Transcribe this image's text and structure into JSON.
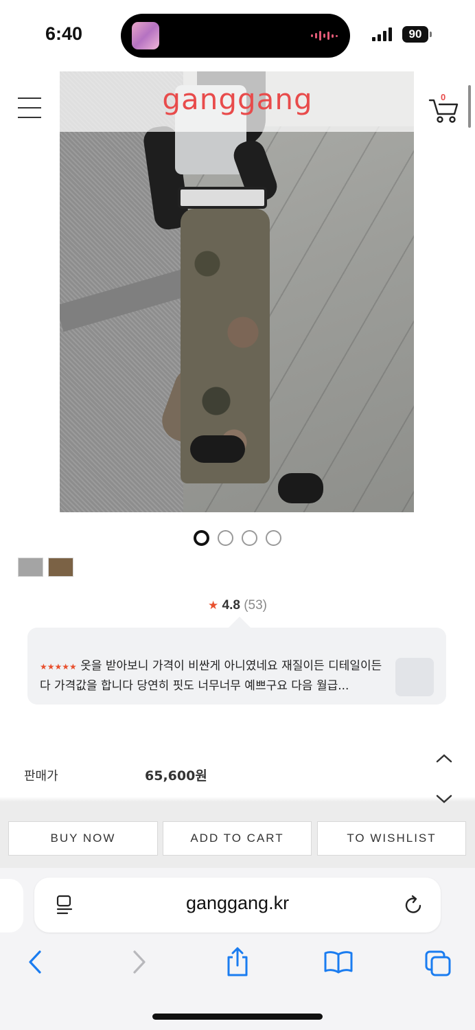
{
  "status_bar": {
    "time": "6:40",
    "battery": "90"
  },
  "header": {
    "logo": "ganggang",
    "cart_count": "0"
  },
  "gallery": {
    "slides": 4,
    "active_index": 0
  },
  "swatches": [
    {
      "color": "#a4a4a4"
    },
    {
      "color": "#7b6245"
    }
  ],
  "rating": {
    "score": "4.8",
    "count": "(53)"
  },
  "review": {
    "stars": "★★★★★",
    "text": "옷을 받아보니 가격이 비싼게 아니였네요 재질이든 디테일이든 다 가격값을 합니다 당연히 핏도 너무너무 예쁘구요 다음 월급..."
  },
  "price": {
    "label": "판매가",
    "value": "65,600원"
  },
  "actions": {
    "buy_now": "BUY NOW",
    "add_to_cart": "ADD TO CART",
    "wishlist": "TO WISHLIST"
  },
  "browser": {
    "url": "ganggang.kr"
  },
  "colors": {
    "accent": "#e84b4b",
    "star": "#e8502e"
  }
}
